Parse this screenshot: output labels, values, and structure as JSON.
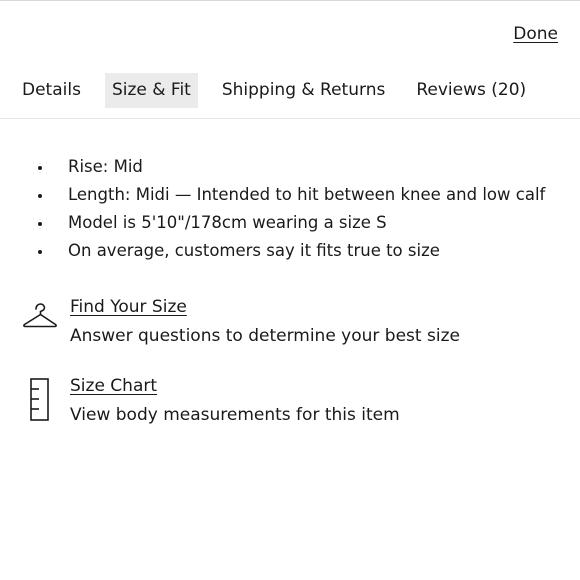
{
  "header": {
    "done_label": "Done"
  },
  "tabs": [
    {
      "label": "Details"
    },
    {
      "label": "Size & Fit"
    },
    {
      "label": "Shipping & Returns"
    },
    {
      "label": "Reviews (20)"
    }
  ],
  "active_tab": "Size & Fit",
  "fit_details": [
    "Rise: Mid",
    "Length: Midi — Intended to hit between knee and low calf",
    "Model is 5'10\"/178cm wearing a size S",
    "On average, customers say it fits true to size"
  ],
  "find_size": {
    "icon": "hanger-icon",
    "title": "Find Your Size",
    "description": "Answer questions to determine your best size"
  },
  "size_chart": {
    "icon": "ruler-icon",
    "title": "Size Chart",
    "description": "View body measurements for this item"
  },
  "colors": {
    "text": "#1a1a1a",
    "active_tab_bg": "#ebebeb",
    "divider": "#e3e3e3"
  }
}
